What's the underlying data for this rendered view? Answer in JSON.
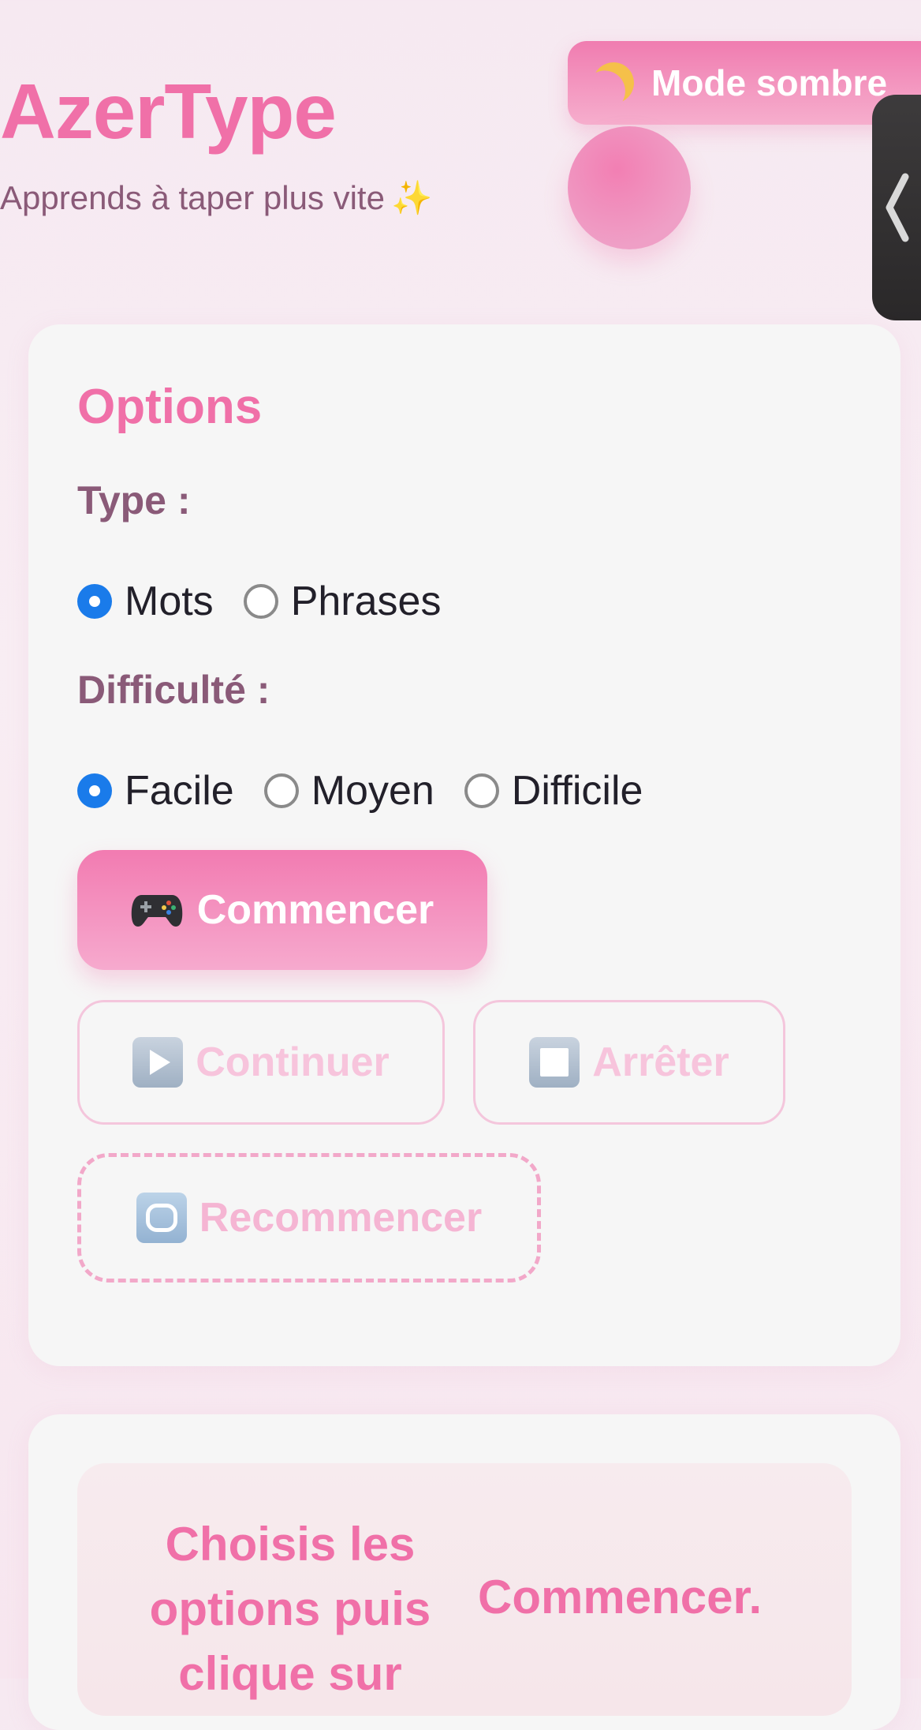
{
  "header": {
    "title": "AzerType",
    "subtitle": "Apprends à taper plus vite",
    "subtitle_emoji": "✨",
    "theme_toggle_label": "Mode sombre",
    "theme_toggle_icon": "moon-icon",
    "side_tab_icon": "chevron-left-icon"
  },
  "options": {
    "title": "Options",
    "type_label": "Type :",
    "type_options": [
      {
        "label": "Mots",
        "checked": true
      },
      {
        "label": "Phrases",
        "checked": false
      }
    ],
    "difficulty_label": "Difficulté :",
    "difficulty_options": [
      {
        "label": "Facile",
        "checked": true
      },
      {
        "label": "Moyen",
        "checked": false
      },
      {
        "label": "Difficile",
        "checked": false
      }
    ],
    "buttons": {
      "start": {
        "label": "Commencer",
        "icon": "gamepad-icon"
      },
      "continue": {
        "label": "Continuer",
        "icon": "play-icon"
      },
      "stop": {
        "label": "Arrêter",
        "icon": "stop-icon"
      },
      "restart": {
        "label": "Recommencer",
        "icon": "repeat-icon"
      }
    }
  },
  "game": {
    "message_part1": "Choisis les options puis clique sur",
    "message_part2": "Commencer."
  },
  "colors": {
    "accent": "#f070a8",
    "label": "#8a5a78",
    "radio_checked": "#1a7bea",
    "disabled_text": "#f7c4dc"
  }
}
